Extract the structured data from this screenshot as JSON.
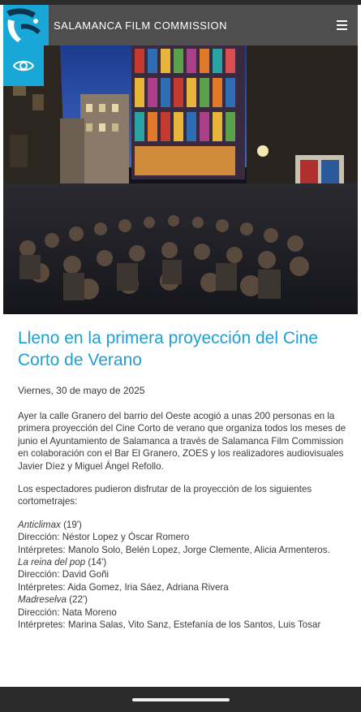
{
  "header": {
    "site_title": "SALAMANCA FILM COMMISSION",
    "menu_icon": "hamburger-menu-icon",
    "logo_icon": "film-commission-logo"
  },
  "accessibility": {
    "icon": "eye-icon"
  },
  "hero": {
    "description_icon": "photo"
  },
  "article": {
    "title": "Lleno en la primera proyección del Cine Corto de Verano",
    "date": "Viernes, 30 de mayo de 2025",
    "paragraphs": [
      "Ayer la calle Granero del barrio del Oeste acogió a unas 200 personas en la primera proyección del Cine Corto de verano que organiza todos los meses de junio el Ayuntamiento de Salamanca a través de Salamanca Film Commission en colaboración con el Bar El Granero, ZOES y los realizadores audiovisuales Javier Díez y Miguel Ángel Refollo.",
      "Los espectadores pudieron disfrutar de la proyección de los siguientes cortometrajes:"
    ],
    "films": [
      {
        "title": "Anticlimax",
        "duration": " (19')",
        "direction": "Dirección: Néstor Lopez y Óscar Romero",
        "cast": "Intérpretes: Manolo Solo, Belén Lopez, Jorge Clemente, Alicia Armenteros."
      },
      {
        "title": "La reina del pop",
        "duration": " (14')",
        "direction": "Dirección: David Goñi",
        "cast": "Intérpretes: Aida Gomez, Iria Sáez, Adriana Rivera"
      },
      {
        "title": "Madreselva",
        "duration": " (22')",
        "direction": "Dirección: Nata Moreno",
        "cast": "Intérpretes: Marina Salas, Vito Sanz, Estefanía de los Santos, Luis Tosar"
      }
    ]
  },
  "colors": {
    "accent": "#18a7d6",
    "title": "#1f9fd1",
    "header_bg": "#4e4e4e"
  }
}
